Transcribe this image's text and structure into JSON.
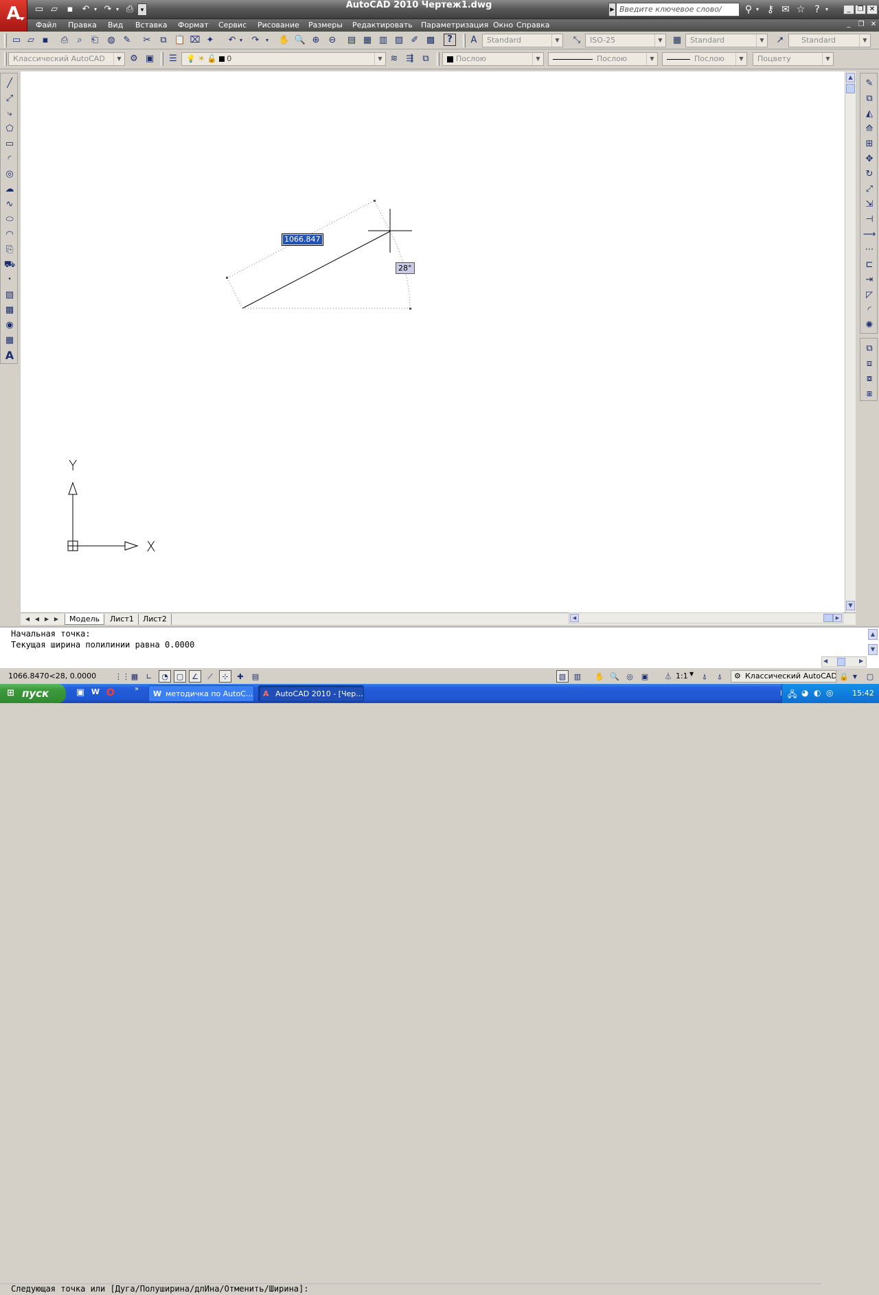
{
  "window": {
    "title": "AutoCAD 2010    Чертеж1.dwg",
    "search_placeholder": "Введите ключевое слово/фразу"
  },
  "menu": [
    "Файл",
    "Правка",
    "Вид",
    "Вставка",
    "Формат",
    "Сервис",
    "Рисование",
    "Размеры",
    "Редактировать",
    "Параметризация",
    "Окно",
    "Справка"
  ],
  "styles_toolbar": {
    "text_style": "Standard",
    "dim_style": "ISO-25",
    "table_style": "Standard",
    "mleader_style": "Standard"
  },
  "workspace_toolbar": {
    "workspace": "Классический AutoCAD",
    "layer": "0",
    "color": "Послою",
    "linetype": "Послою",
    "lineweight": "Послою",
    "plot_style": "Поцвету"
  },
  "drawing": {
    "length_input": "1066.847",
    "angle_input": "28°",
    "axis_x": "X",
    "axis_y": "Y"
  },
  "layout_tabs": [
    "Модель",
    "Лист1",
    "Лист2"
  ],
  "command": {
    "history": [
      "Начальная точка:",
      "Текущая ширина полилинии равна 0.0000"
    ],
    "prompt": "Следующая точка или [Дуга/Полуширина/длИна/Отменить/Ширина]:"
  },
  "status": {
    "coordinates": "1066.8470<28, 0.0000",
    "annotation_scale": "1:1",
    "workspace": "Классический AutoCAD"
  },
  "taskbar": {
    "start_label": "пуск",
    "tasks": [
      "методичка по AutoC...",
      "AutoCAD 2010 - [Чер..."
    ],
    "language": "EN",
    "clock": "15:42"
  }
}
